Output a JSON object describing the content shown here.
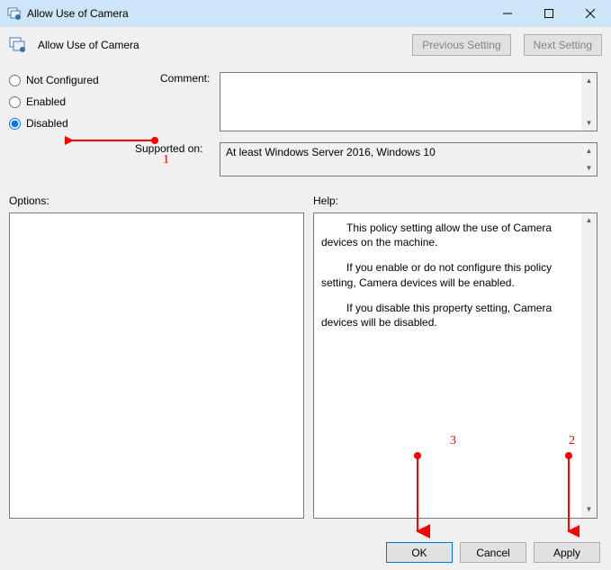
{
  "window": {
    "title": "Allow Use of Camera"
  },
  "header": {
    "policy_title": "Allow Use of Camera",
    "previous_setting": "Previous Setting",
    "next_setting": "Next Setting"
  },
  "radios": {
    "not_configured": "Not Configured",
    "enabled": "Enabled",
    "disabled": "Disabled",
    "selected": "disabled"
  },
  "labels": {
    "comment": "Comment:",
    "supported_on": "Supported on:",
    "options": "Options:",
    "help": "Help:"
  },
  "fields": {
    "comment_value": "",
    "supported_text": "At least Windows Server 2016, Windows 10"
  },
  "help_text": {
    "p1": "This policy setting allow the use of Camera devices on the machine.",
    "p2": "If you enable or do not configure this policy setting, Camera devices will be enabled.",
    "p3": "If you disable this property setting, Camera devices will be disabled."
  },
  "buttons": {
    "ok": "OK",
    "cancel": "Cancel",
    "apply": "Apply"
  },
  "annotations": {
    "n1": "1",
    "n2": "2",
    "n3": "3"
  }
}
